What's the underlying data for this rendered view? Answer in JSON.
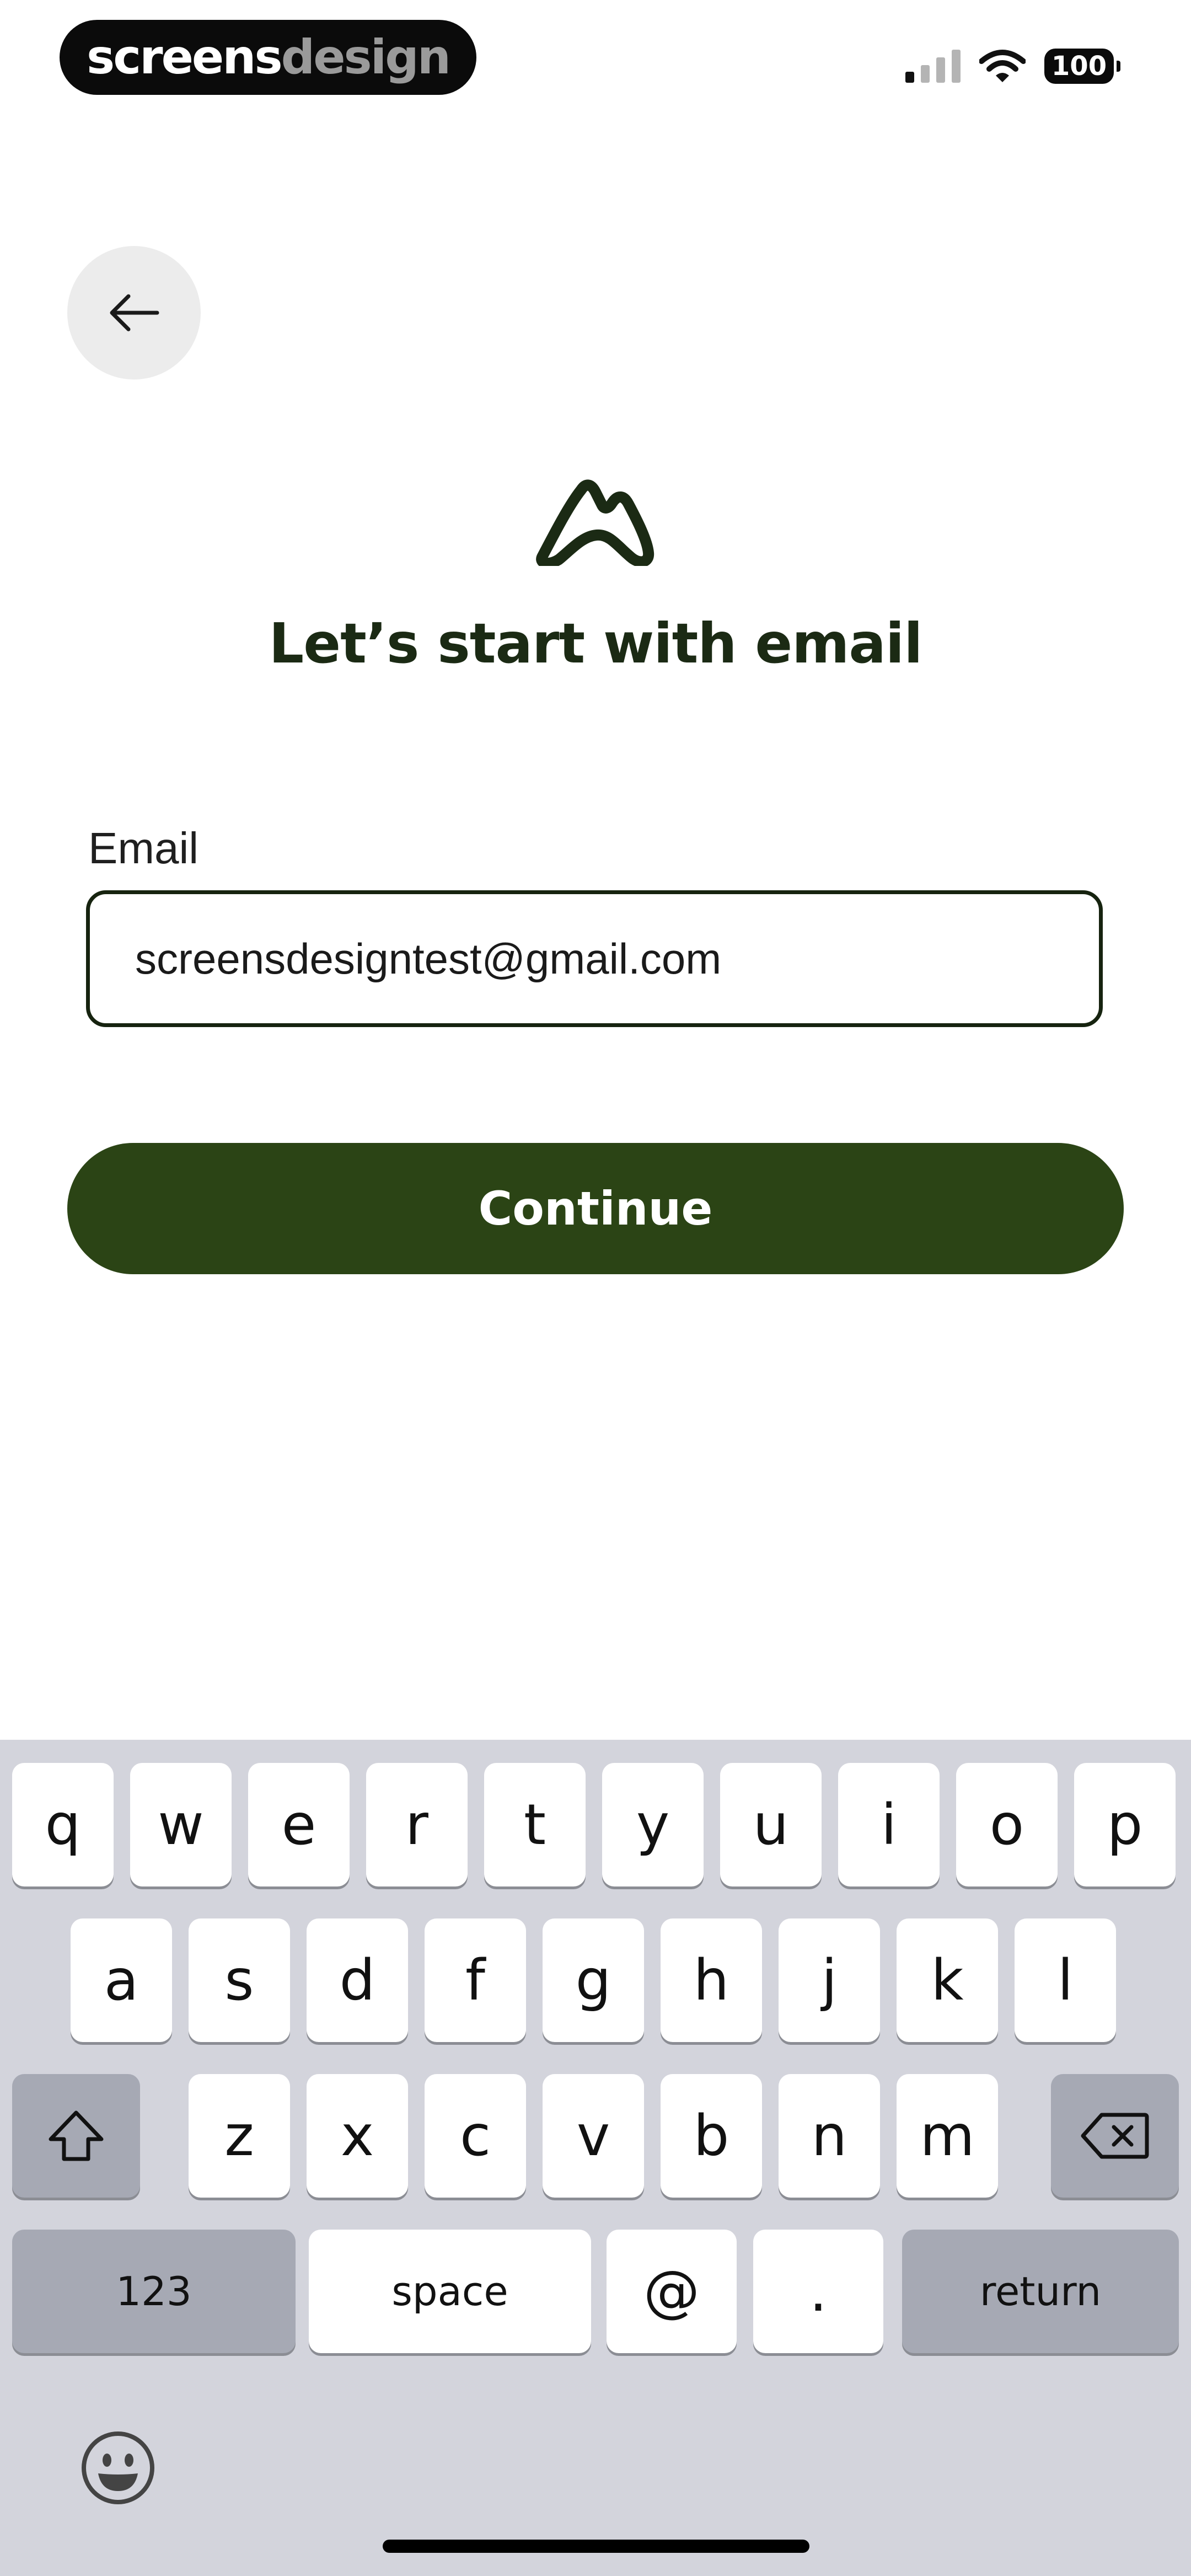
{
  "status_bar": {
    "brand_part1": "screens",
    "brand_part2": "design",
    "battery": "100",
    "icons": [
      "signal-icon",
      "wifi-icon",
      "battery-icon"
    ]
  },
  "header": {
    "back_icon": "arrow-left-icon",
    "logo_icon": "mountain-logo-icon",
    "title": "Let’s start with email"
  },
  "form": {
    "email_label": "Email",
    "email_value": "screensdesigntest@gmail.com"
  },
  "actions": {
    "continue_label": "Continue"
  },
  "keyboard": {
    "row1": [
      "q",
      "w",
      "e",
      "r",
      "t",
      "y",
      "u",
      "i",
      "o",
      "p"
    ],
    "row2": [
      "a",
      "s",
      "d",
      "f",
      "g",
      "h",
      "j",
      "k",
      "l"
    ],
    "row3": [
      "z",
      "x",
      "c",
      "v",
      "b",
      "n",
      "m"
    ],
    "numbers_label": "123",
    "space_label": "space",
    "at_label": "@",
    "dot_label": ".",
    "return_label": "return",
    "shift_icon": "shift-icon",
    "delete_icon": "backspace-icon",
    "emoji_icon": "emoji-icon"
  },
  "colors": {
    "accent": "#2b4415",
    "title": "#1b2a14",
    "keyboard_bg": "#d3d4dc"
  }
}
